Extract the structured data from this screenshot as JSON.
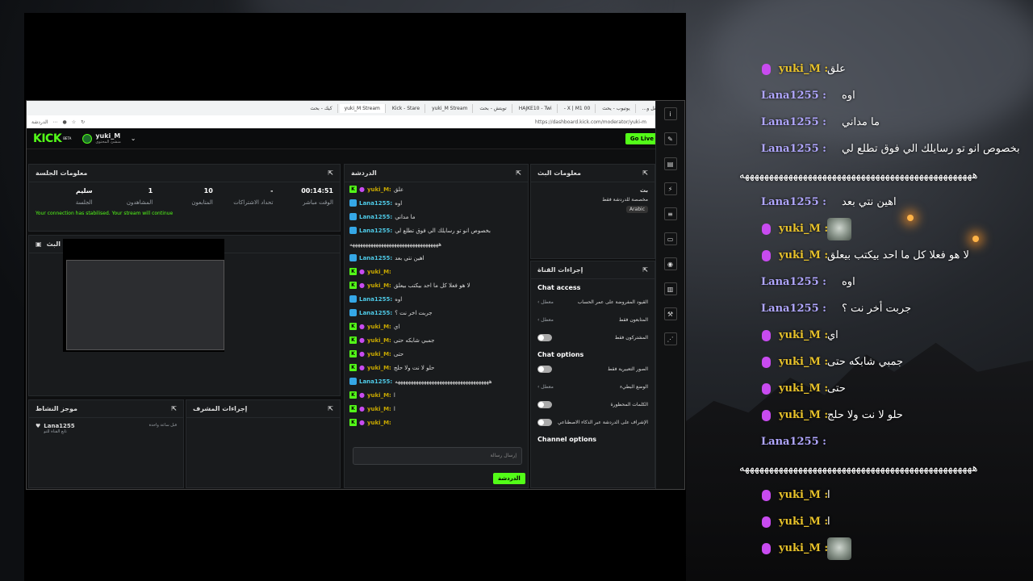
{
  "browser": {
    "tabs": [
      "متكامن أتقل و...",
      "يوتيوب - يحث",
      "00 X | M1 -",
      "HAJKE10 - Twi",
      "تويتش - بحث",
      "yuki_M Stream",
      "Kick - Stare",
      "yuki_M Stream",
      "كيك - بحث"
    ],
    "url": "https://dashboard.kick.com/moderator/yuki-m",
    "bookmark": "الدردشة"
  },
  "kick": {
    "logo": "KICK",
    "beta": "BETA",
    "username": "yuki_M",
    "user_sub": "منشئ المحتوى",
    "go_live": "Go Live"
  },
  "session": {
    "title": "معلومات الجلسة",
    "stats": [
      {
        "value": "00:14:51",
        "label": "الوقت مباشر"
      },
      {
        "value": "-",
        "label": "تحداد الاشتراكات"
      },
      {
        "value": "10",
        "label": "المتابعون"
      },
      {
        "value": "1",
        "label": "المشاهدون"
      },
      {
        "value": "سليم",
        "label": "الجلسة"
      }
    ],
    "notice": "Your connection has stabilised. Your stream will continue"
  },
  "preview": {
    "title": "مراجعة البث"
  },
  "activity": {
    "title": "موجز النشاط",
    "user": "Lana1255",
    "desc": "تابع القناة للتو",
    "time": "قبل ساعة واحدة"
  },
  "mod_actions": {
    "title": "إجراءات المشرف"
  },
  "chat": {
    "title": "الدردشة",
    "messages": [
      {
        "user": "yuki_M",
        "text": "علق"
      },
      {
        "user": "Lana1255",
        "text": "اوه"
      },
      {
        "user": "Lana1255",
        "text": "ما مداني"
      },
      {
        "user": "Lana1255",
        "text": "بخصوص انو تو رسايلك الي فوق تطلع لي"
      },
      {
        "user": "",
        "text": "ههههههههههههههههههههههههههههههههههه"
      },
      {
        "user": "Lana1255",
        "text": "اهين نتي بعد"
      },
      {
        "user": "yuki_M",
        "text": ""
      },
      {
        "user": "yuki_M",
        "text": "لا هو فعلا كل ما احد بيكتب بيعلق"
      },
      {
        "user": "Lana1255",
        "text": "اوه"
      },
      {
        "user": "Lana1255",
        "text": "جربت اخر نت ؟"
      },
      {
        "user": "yuki_M",
        "text": "اي"
      },
      {
        "user": "yuki_M",
        "text": "جمبي شابكه حتى"
      },
      {
        "user": "yuki_M",
        "text": "حتى"
      },
      {
        "user": "yuki_M",
        "text": "حلو لا نت ولا حلج"
      },
      {
        "user": "Lana1255",
        "text": "ههههههههههههههههههههههههههههههههههههه"
      },
      {
        "user": "yuki_M",
        "text": "ا"
      },
      {
        "user": "yuki_M",
        "text": "ا"
      },
      {
        "user": "yuki_M",
        "text": ""
      }
    ],
    "input_placeholder": "إرسال رسالة",
    "send": "الدردشة"
  },
  "stream_info": {
    "title": "معلومات البث",
    "category": "مخصصة للدردشة فقط",
    "heading": "بث",
    "language": "Arabic"
  },
  "channel_actions": {
    "title": "إجراءات القناة",
    "chat_access": "Chat access",
    "rows1": [
      {
        "label": "القيود المفروضة على عمر الحساب",
        "state": "معطل"
      },
      {
        "label": "المتابعون فقط",
        "state": "معطل"
      },
      {
        "label": "المشتركون فقط",
        "state": ""
      }
    ],
    "chat_options": "Chat options",
    "rows2": [
      {
        "label": "الصور التعبيرية فقط",
        "state": ""
      },
      {
        "label": "الوضع البطيء",
        "state": "معطل"
      },
      {
        "label": "الكلمات المحظورة",
        "state": ""
      },
      {
        "label": "الإشراف على الدردشة عبر الذكاء الاصطناعي",
        "state": ""
      }
    ],
    "channel_options": "Channel options"
  },
  "overlay": {
    "lines": [
      {
        "user": "yuki_M",
        "msg": "علق",
        "type": "yuki"
      },
      {
        "user": "Lana1255",
        "msg": "اوه",
        "type": "lana"
      },
      {
        "user": "Lana1255",
        "msg": "ما مداني",
        "type": "lana"
      },
      {
        "user": "Lana1255",
        "msg": "بخصوص انو تو رسايلك الي فوق تطلع لي",
        "type": "lana"
      },
      {
        "user": "",
        "msg": "ههههههههههههههههههههههههههههههههههههههههههههههههه",
        "type": "cont"
      },
      {
        "user": "Lana1255",
        "msg": "اهين نتي بعد",
        "type": "lana"
      },
      {
        "user": "yuki_M",
        "msg": "",
        "type": "yuki-emote"
      },
      {
        "user": "yuki_M",
        "msg": "لا هو فعلا كل ما احد بيكتب بيعلق",
        "type": "yuki"
      },
      {
        "user": "Lana1255",
        "msg": "اوه",
        "type": "lana"
      },
      {
        "user": "Lana1255",
        "msg": "جربت أخر نت ؟",
        "type": "lana"
      },
      {
        "user": "yuki_M",
        "msg": "اي",
        "type": "yuki"
      },
      {
        "user": "yuki_M",
        "msg": "جمبي شابكه حتى",
        "type": "yuki"
      },
      {
        "user": "yuki_M",
        "msg": "حتى",
        "type": "yuki"
      },
      {
        "user": "yuki_M",
        "msg": "حلو لا نت ولا حلج",
        "type": "yuki"
      },
      {
        "user": "Lana1255",
        "msg": "",
        "type": "lana"
      },
      {
        "user": "",
        "msg": "ههههههههههههههههههههههههههههههههههههههههههههههههه",
        "type": "cont"
      },
      {
        "user": "yuki_M",
        "msg": "ا",
        "type": "yuki"
      },
      {
        "user": "yuki_M",
        "msg": "ا",
        "type": "yuki"
      },
      {
        "user": "yuki_M",
        "msg": "",
        "type": "yuki-emote"
      }
    ]
  }
}
